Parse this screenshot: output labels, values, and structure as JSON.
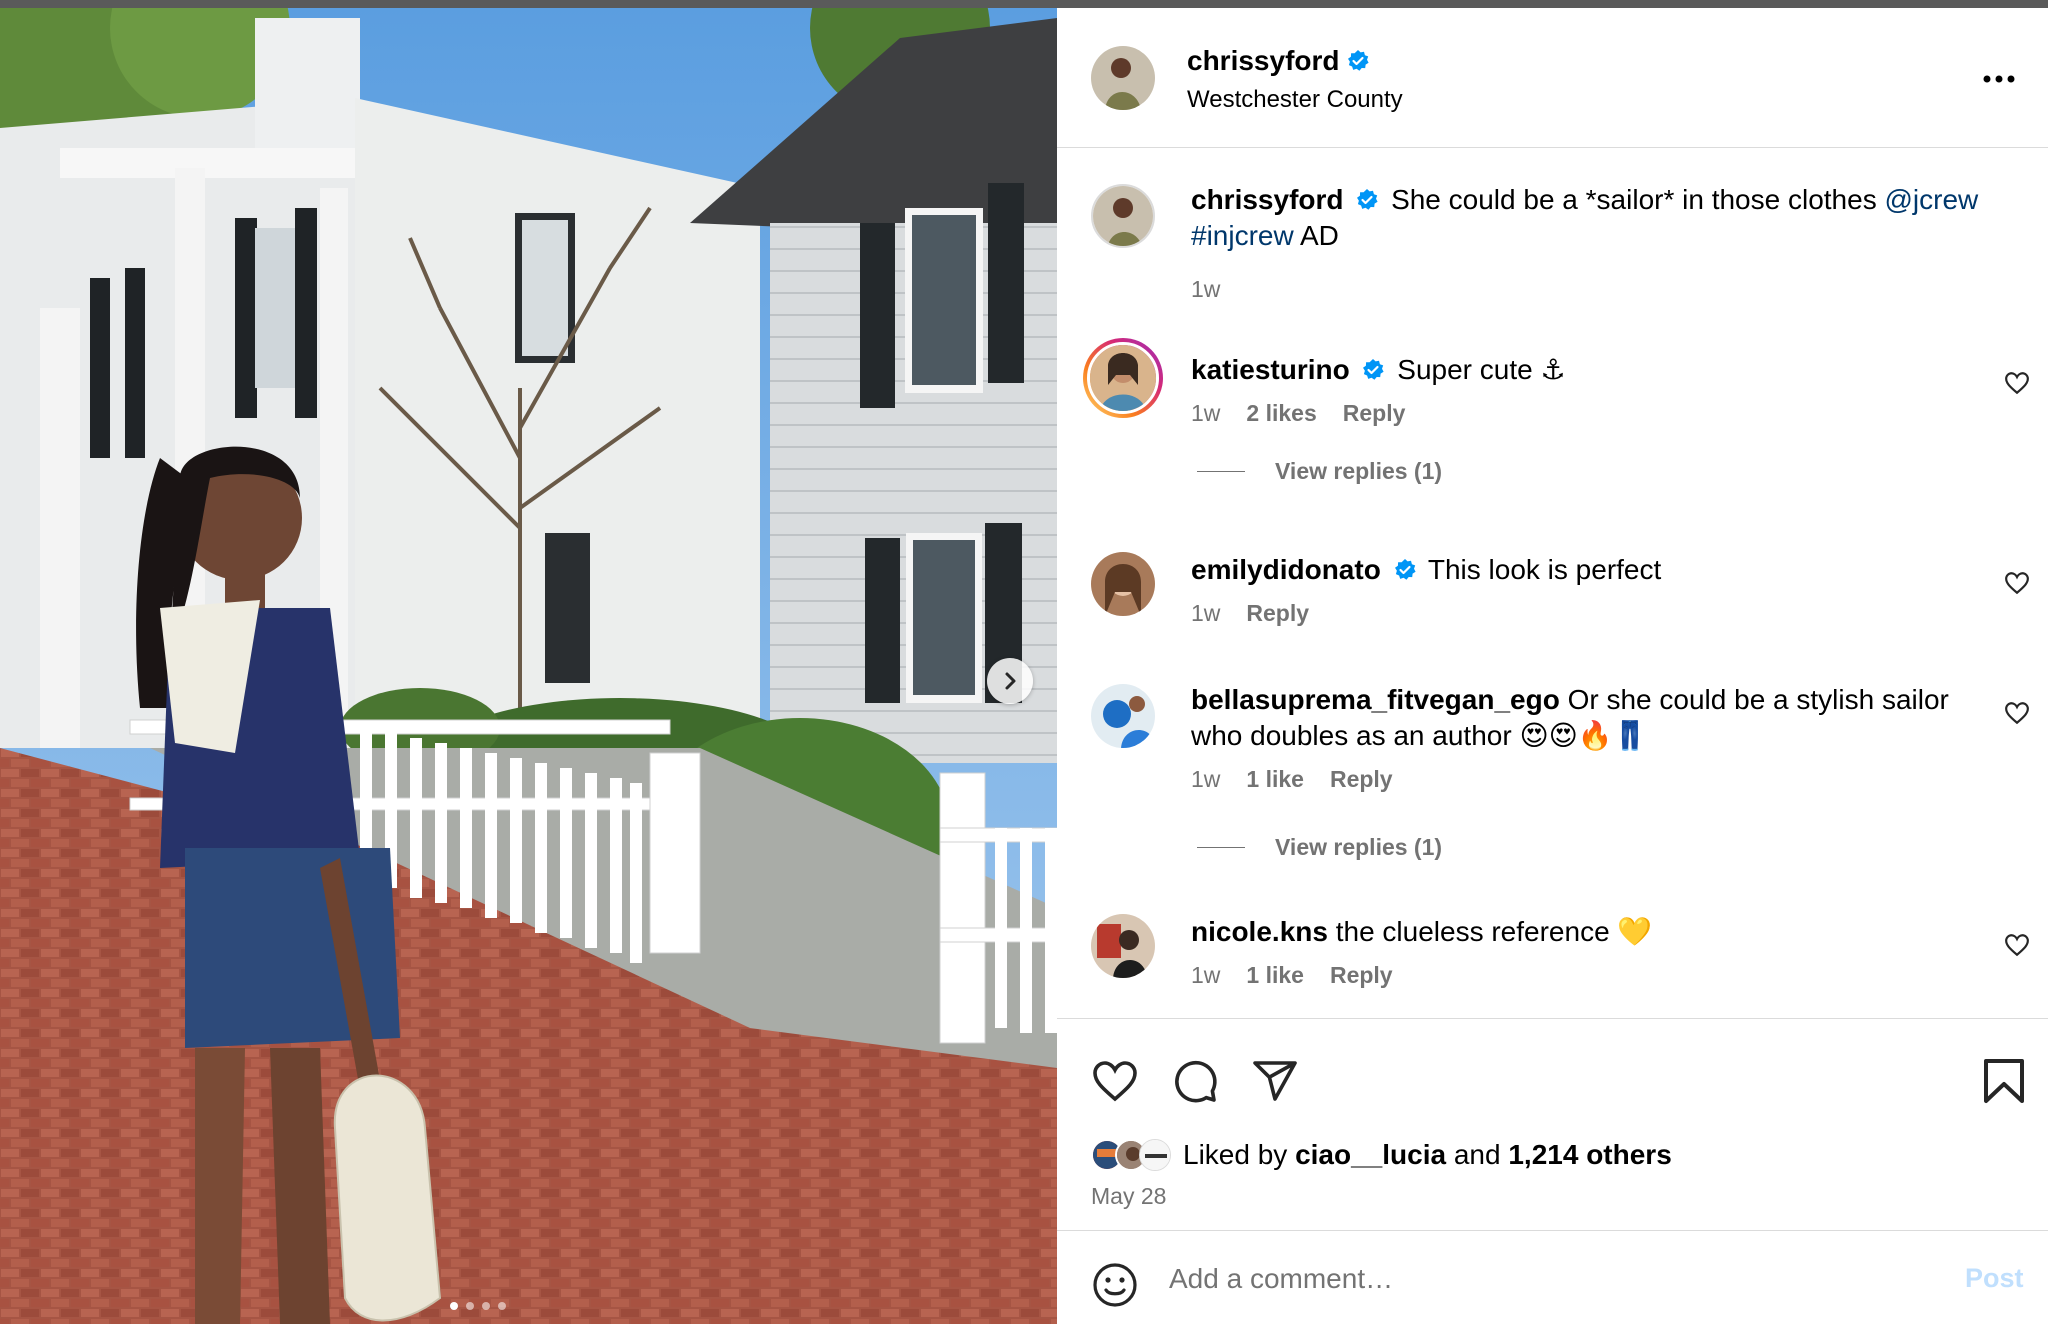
{
  "post": {
    "username": "chrissyford",
    "location": "Westchester County",
    "more_icon": "more-horizontal-icon"
  },
  "caption": {
    "username": "chrissyford",
    "text": "She could be a *sailor* in those clothes",
    "mention": "@jcrew",
    "hashtag": "#injcrew",
    "suffix": "AD",
    "time": "1w"
  },
  "comments": [
    {
      "username": "katiesturino",
      "verified": true,
      "text": "Super cute ⚓",
      "time": "1w",
      "likes": "2 likes",
      "reply": "Reply",
      "view_replies": "View replies (1)"
    },
    {
      "username": "emilydidonato",
      "verified": true,
      "text": "This look is perfect",
      "time": "1w",
      "likes": "",
      "reply": "Reply",
      "view_replies": ""
    },
    {
      "username": "bellasuprema_fitvegan_ego",
      "verified": false,
      "text": "Or she could be a stylish sailor who doubles as an author 😍😍🔥👖",
      "time": "1w",
      "likes": "1 like",
      "reply": "Reply",
      "view_replies": "View replies (1)"
    },
    {
      "username": "nicole.kns",
      "verified": false,
      "text": "the clueless reference 💛",
      "time": "1w",
      "likes": "1 like",
      "reply": "Reply",
      "view_replies": ""
    }
  ],
  "likes": {
    "prefix": "Liked by",
    "user": "ciao__lucia",
    "conj": "and",
    "others": "1,214 others"
  },
  "date": "May 28",
  "add_comment": {
    "placeholder": "Add a comment…",
    "post_label": "Post"
  },
  "carousel": {
    "count": 4,
    "active": 1
  },
  "colors": {
    "link": "#00376b",
    "verified": "#0095f6",
    "muted": "#737373",
    "post_disabled": "#c0dffd"
  }
}
